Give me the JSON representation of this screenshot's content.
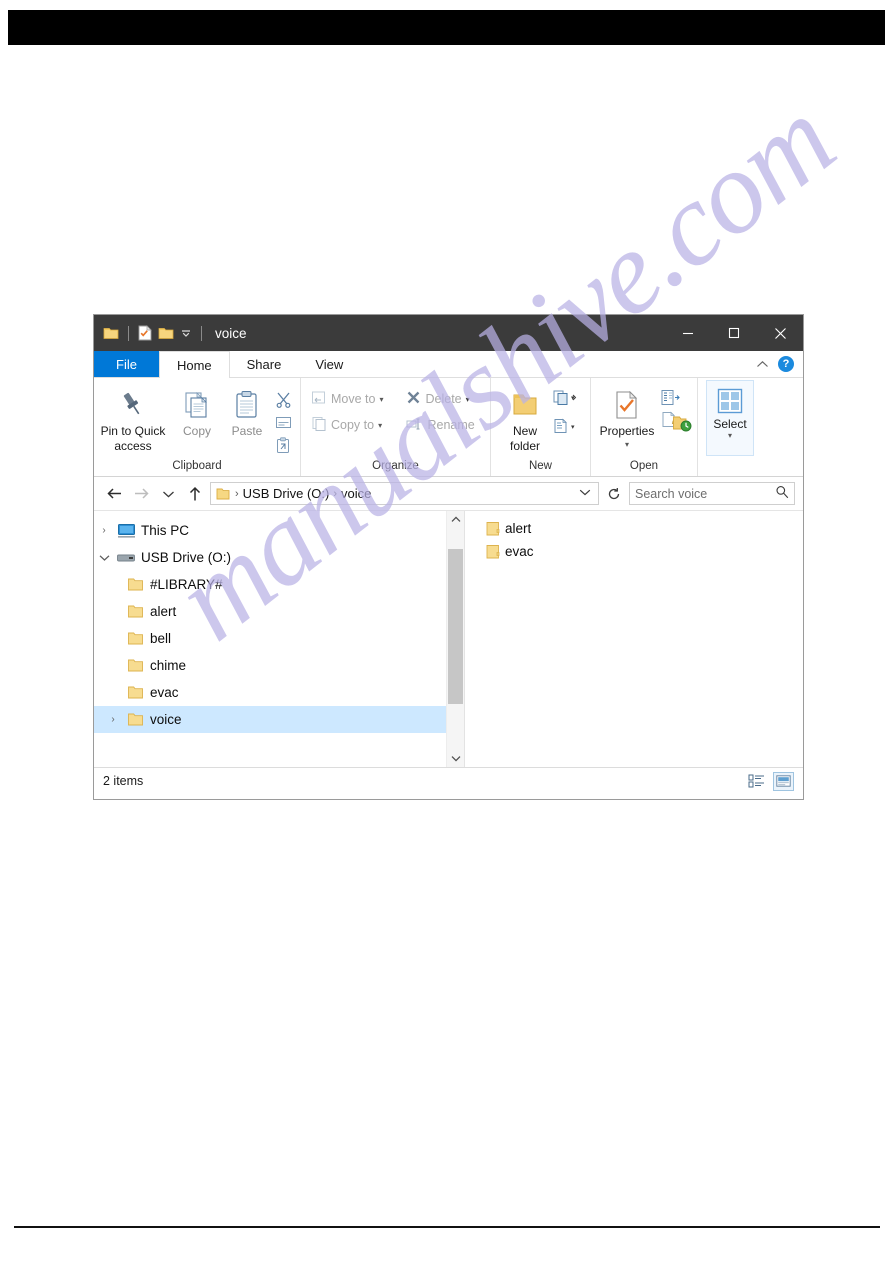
{
  "page": {
    "top_bar_present": true,
    "bottom_rule_present": true,
    "watermark_text": "manualshive.com",
    "watermark_color": "#b9b2e6"
  },
  "window": {
    "title": "voice",
    "accent_color": "#0078d7",
    "titlebar_color": "#3b3b3b",
    "quick_access": [
      {
        "name": "folder-icon",
        "label": "Folder"
      },
      {
        "name": "properties-icon",
        "label": "Properties"
      },
      {
        "name": "new-folder-icon",
        "label": "New folder"
      },
      {
        "name": "chevron-down-icon",
        "label": "Customize Quick Access Toolbar"
      }
    ],
    "controls": {
      "minimize": "Minimize",
      "maximize": "Maximize",
      "close": "Close"
    }
  },
  "tabs": {
    "file_label": "File",
    "items": [
      {
        "label": "Home",
        "active": true
      },
      {
        "label": "Share",
        "active": false
      },
      {
        "label": "View",
        "active": false
      }
    ],
    "collapse_label": "Minimize the Ribbon",
    "help_label": "?"
  },
  "ribbon": {
    "groups": [
      {
        "name": "clipboard",
        "label": "Clipboard",
        "big_buttons": [
          {
            "label": "Pin to Quick\naccess",
            "line1": "Pin to Quick",
            "line2": "access",
            "icon": "pin-icon",
            "enabled": true
          },
          {
            "label": "Copy",
            "line1": "Copy",
            "line2": "",
            "icon": "copy-icon",
            "enabled": true
          },
          {
            "label": "Paste",
            "line1": "Paste",
            "line2": "",
            "icon": "paste-icon",
            "enabled": true
          }
        ],
        "mini_buttons": [
          {
            "label": "Cut",
            "icon": "scissors-icon"
          },
          {
            "label": "Copy path",
            "icon": "copy-path-icon"
          },
          {
            "label": "Paste shortcut",
            "icon": "paste-shortcut-icon"
          }
        ]
      },
      {
        "name": "organize",
        "label": "Organize",
        "small_buttons": [
          {
            "label": "Move to",
            "icon": "move-to-icon",
            "has_caret": true,
            "enabled": false
          },
          {
            "label": "Copy to",
            "icon": "copy-to-icon",
            "has_caret": true,
            "enabled": false
          },
          {
            "label": "Delete",
            "icon": "delete-x-icon",
            "has_caret": true,
            "enabled": false
          },
          {
            "label": "Rename",
            "icon": "rename-icon",
            "has_caret": false,
            "enabled": false
          }
        ]
      },
      {
        "name": "new",
        "label": "New",
        "big_buttons": [
          {
            "line1": "New",
            "line2": "folder",
            "icon": "new-folder-icon",
            "enabled": true
          }
        ],
        "mini_buttons": [
          {
            "label": "New item",
            "icon": "new-item-icon",
            "has_caret": true
          },
          {
            "label": "Easy access",
            "icon": "easy-access-icon",
            "has_caret": true
          }
        ]
      },
      {
        "name": "open",
        "label": "Open",
        "big_buttons": [
          {
            "line1": "Properties",
            "line2": "",
            "icon": "properties-check-icon",
            "has_caret": true,
            "enabled": true
          }
        ],
        "mini_buttons": [
          {
            "label": "Open",
            "icon": "open-icon",
            "has_caret": true
          },
          {
            "label": "Edit",
            "icon": "edit-icon",
            "has_caret": false
          },
          {
            "label": "History",
            "icon": "history-icon",
            "has_caret": false
          }
        ]
      },
      {
        "name": "select",
        "label": "",
        "big_buttons": [
          {
            "line1": "Select",
            "line2": "",
            "icon": "select-grid-icon",
            "has_caret": true,
            "enabled": true,
            "highlighted": true
          }
        ]
      }
    ]
  },
  "address": {
    "back_label": "Back",
    "forward_label": "Forward",
    "recent_label": "Recent locations",
    "up_label": "Up",
    "breadcrumbs": [
      {
        "label": "USB Drive (O:)"
      },
      {
        "label": "voice"
      }
    ],
    "dropdown_label": "Previous locations",
    "refresh_label": "Refresh",
    "search_placeholder": "Search voice"
  },
  "nav_tree": [
    {
      "label": "This PC",
      "icon": "monitor-icon",
      "indent": 0,
      "chevron": "collapsed",
      "selected": false
    },
    {
      "label": "USB Drive (O:)",
      "icon": "usb-drive-icon",
      "indent": 0,
      "chevron": "expanded",
      "selected": false
    },
    {
      "label": "#LIBRARY#",
      "icon": "folder-icon",
      "indent": 1,
      "chevron": "none",
      "selected": false
    },
    {
      "label": "alert",
      "icon": "folder-icon",
      "indent": 1,
      "chevron": "none",
      "selected": false
    },
    {
      "label": "bell",
      "icon": "folder-icon",
      "indent": 1,
      "chevron": "none",
      "selected": false
    },
    {
      "label": "chime",
      "icon": "folder-icon",
      "indent": 1,
      "chevron": "none",
      "selected": false
    },
    {
      "label": "evac",
      "icon": "folder-icon",
      "indent": 1,
      "chevron": "none",
      "selected": false
    },
    {
      "label": "voice",
      "icon": "folder-icon",
      "indent": 1,
      "chevron": "collapsed",
      "selected": true
    }
  ],
  "file_list": [
    {
      "label": "alert",
      "icon": "folder-icon"
    },
    {
      "label": "evac",
      "icon": "folder-icon"
    }
  ],
  "status": {
    "item_count_text": "2 items",
    "views": [
      {
        "name": "details-view",
        "label": "Details view",
        "active": false
      },
      {
        "name": "large-icons-view",
        "label": "Large icons view",
        "active": true
      }
    ]
  }
}
